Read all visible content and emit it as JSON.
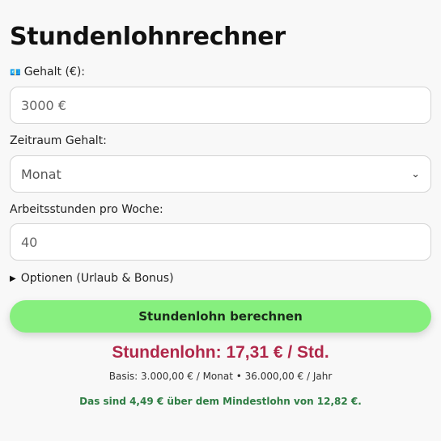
{
  "title": "Stundenlohnrechner",
  "salary": {
    "icon": "money-icon",
    "label": "Gehalt (€):",
    "placeholder": "3000 €",
    "value": ""
  },
  "period": {
    "label": "Zeitraum Gehalt:",
    "selected": "Monat"
  },
  "hours": {
    "label": "Arbeitsstunden pro Woche:",
    "placeholder": "40",
    "value": ""
  },
  "options": {
    "label": "Optionen (Urlaub & Bonus)"
  },
  "calculate_button": "Stundenlohn berechnen",
  "result": {
    "main": "Stundenlohn: 17,31 € / Std.",
    "basis": "Basis: 3.000,00 € / Monat • 36.000,00 € / Jahr",
    "min_wage_note": "Das sind 4,49 € über dem Mindestlohn von 12,82 €."
  },
  "colors": {
    "button": "#86ef7e",
    "result_main": "#b0284a",
    "result_note": "#2e7d43"
  }
}
